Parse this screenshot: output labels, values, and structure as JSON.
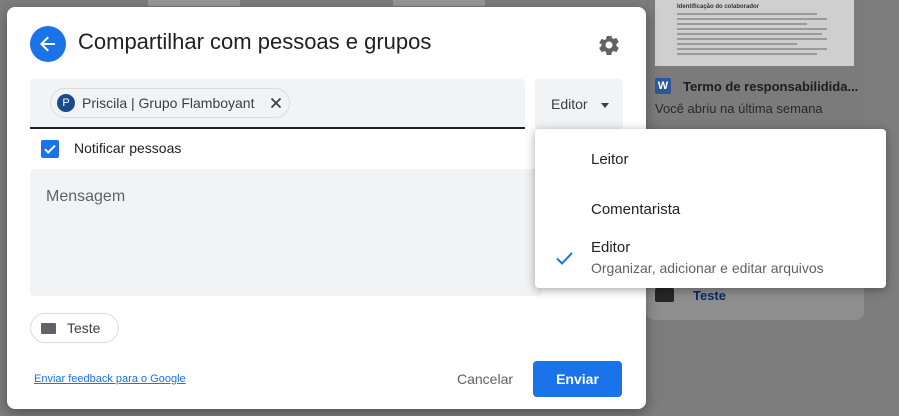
{
  "dialog": {
    "title": "Compartilhar com pessoas e grupos",
    "recipient_chip": {
      "avatar_letter": "P",
      "label": "Priscila | Grupo Flamboyant"
    },
    "role_button_label": "Editor",
    "notify_label": "Notificar pessoas",
    "notify_checked": true,
    "message_placeholder": "Mensagem",
    "folder_chip_label": "Teste",
    "feedback_link": "Enviar feedback para o Google",
    "cancel_label": "Cancelar",
    "send_label": "Enviar"
  },
  "role_menu": {
    "items": [
      {
        "label": "Leitor",
        "description": "",
        "selected": false
      },
      {
        "label": "Comentarista",
        "description": "",
        "selected": false
      },
      {
        "label": "Editor",
        "description": "Organizar, adicionar e editar arquivos",
        "selected": true
      }
    ]
  },
  "background": {
    "doc_heading": "Identificação do colaborador",
    "file_icon_letter": "W",
    "file_name": "Termo de responsabilidida...",
    "file_subtitle": "Você abriu na última semana",
    "folder_name": "Teste"
  },
  "colors": {
    "accent": "#1a73e8",
    "avatar": "#1a4b8c",
    "word_blue": "#2b579a",
    "scrim": "#7d7d7d"
  }
}
